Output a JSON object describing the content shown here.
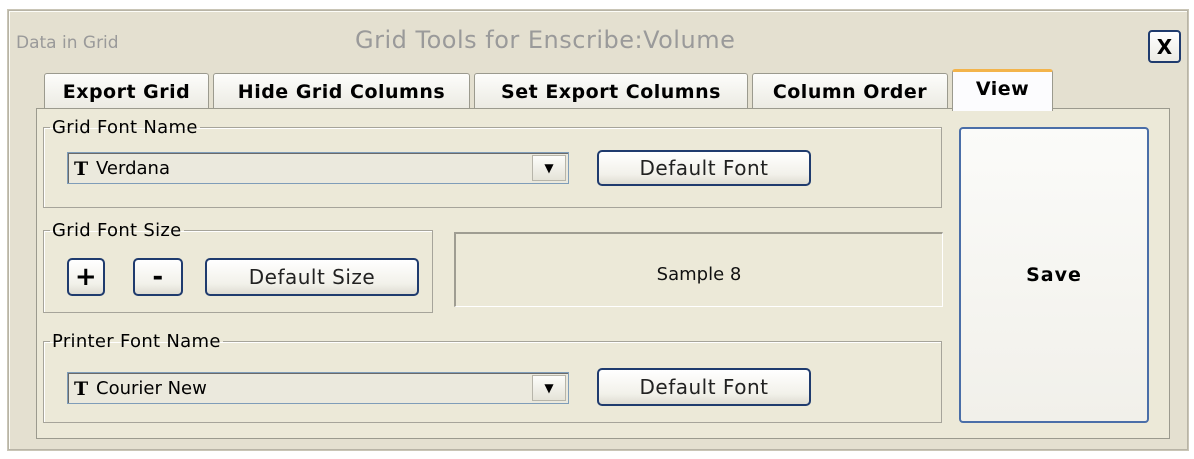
{
  "window": {
    "left_title": "Data in Grid",
    "title": "Grid Tools for Enscribe:Volume",
    "close_label": "X"
  },
  "tabs": [
    {
      "label": "Export Grid",
      "active": false
    },
    {
      "label": "Hide Grid Columns",
      "active": false
    },
    {
      "label": "Set Export Columns",
      "active": false
    },
    {
      "label": "Column Order",
      "active": false
    },
    {
      "label": "View",
      "active": true
    }
  ],
  "grid_font_name": {
    "legend": "Grid Font Name",
    "value": "Verdana",
    "default_button": "Default Font"
  },
  "grid_font_size": {
    "legend": "Grid Font Size",
    "plus_label": "+",
    "minus_label": "-",
    "default_button": "Default Size"
  },
  "sample": {
    "text": "Sample 8"
  },
  "printer_font_name": {
    "legend": "Printer Font Name",
    "value": "Courier New",
    "default_button": "Default Font"
  },
  "save_label": "Save",
  "icons": {
    "font_icon": "T",
    "dropdown_arrow": "▼"
  },
  "colors": {
    "tab_active_accent": "#f3b44b",
    "button_border": "#1f3b6e",
    "panel_bg": "#ece9d8"
  }
}
